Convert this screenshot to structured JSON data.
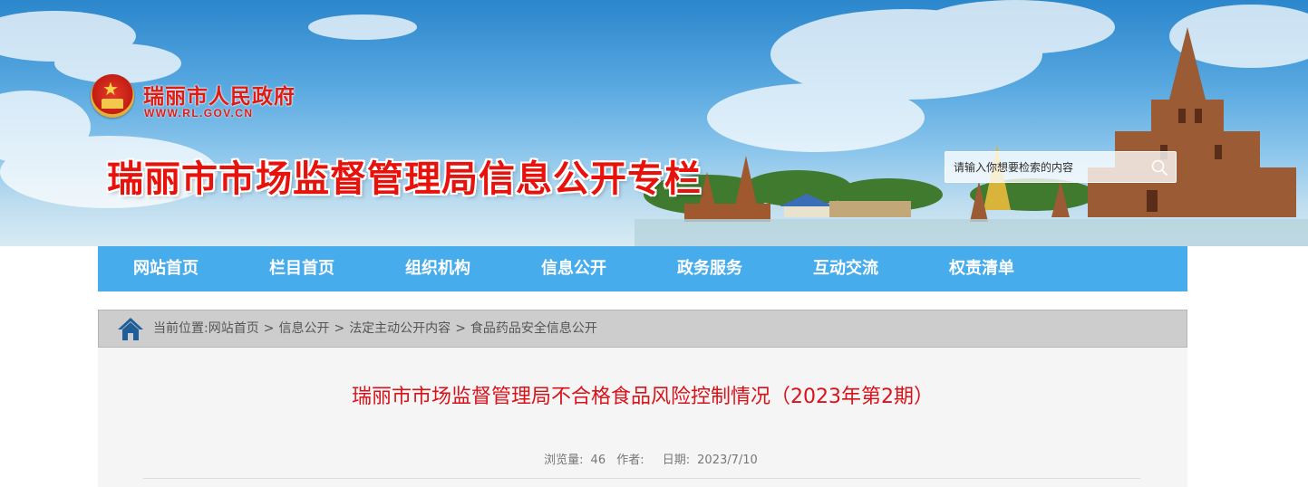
{
  "header": {
    "gov_name": "瑞丽市人民政府",
    "gov_url": "WWW.RL.GOV.CN",
    "site_title": "瑞丽市市场监督管理局信息公开专栏",
    "search": {
      "placeholder": "请输入你想要检索的内容",
      "icon": "search-icon"
    },
    "emblem_icon": "national-emblem-icon"
  },
  "nav": {
    "items": [
      {
        "label": "网站首页"
      },
      {
        "label": "栏目首页"
      },
      {
        "label": "组织机构"
      },
      {
        "label": "信息公开"
      },
      {
        "label": "政务服务"
      },
      {
        "label": "互动交流"
      },
      {
        "label": "权责清单"
      }
    ]
  },
  "breadcrumb": {
    "icon": "home-icon",
    "prefix": "当前位置:",
    "items": [
      "网站首页",
      "信息公开",
      "法定主动公开内容",
      "食品药品安全信息公开"
    ],
    "separator": ">"
  },
  "article": {
    "title": "瑞丽市市场监督管理局不合格食品风险控制情况（2023年第2期）",
    "views_label": "浏览量:",
    "views": "46",
    "author_label": "作者:",
    "author": "",
    "date_label": "日期:",
    "date": "2023/7/10"
  },
  "colors": {
    "nav_bg": "#47acec",
    "title_red": "#d9121a",
    "site_title_red": "#e8120c",
    "breadcrumb_bg": "#cdcdcd",
    "home_icon_blue": "#1e5f99"
  }
}
